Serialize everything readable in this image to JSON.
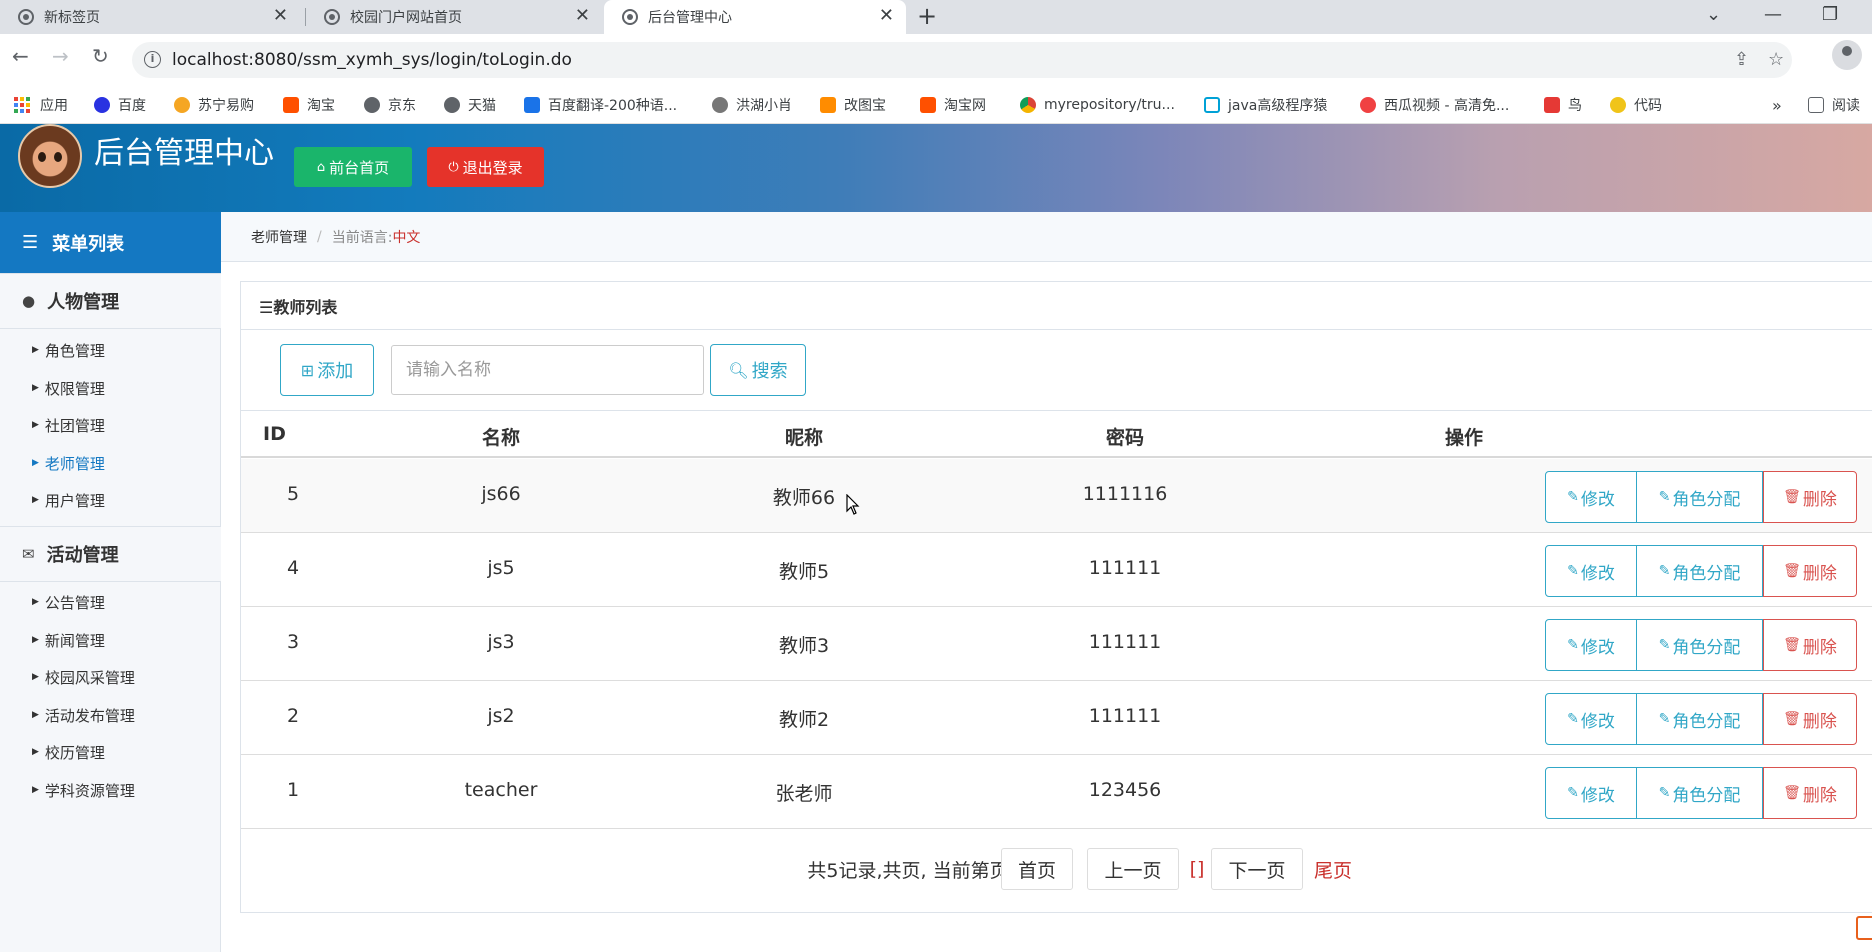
{
  "browser": {
    "tabs": [
      {
        "title": "新标签页",
        "icon": "chrome-icon"
      },
      {
        "title": "校园门户网站首页",
        "icon": "globe-icon"
      },
      {
        "title": "后台管理中心",
        "icon": "globe-icon",
        "active": true
      }
    ],
    "url": "localhost:8080/ssm_xymh_sys/login/toLogin.do",
    "bookmarks": [
      {
        "label": "应用",
        "icon": "apps-grid-icon"
      },
      {
        "label": "百度",
        "icon": "baidu-paw-icon",
        "color": "#2932e1"
      },
      {
        "label": "苏宁易购",
        "icon": "suning-icon",
        "color": "#f5a623"
      },
      {
        "label": "淘宝",
        "icon": "taobao-icon",
        "color": "#ff5000"
      },
      {
        "label": "京东",
        "icon": "globe-icon",
        "color": "#5f6368"
      },
      {
        "label": "天猫",
        "icon": "globe-icon",
        "color": "#5f6368"
      },
      {
        "label": "百度翻译-200种语...",
        "icon": "translate-icon",
        "color": "#1a73e8"
      },
      {
        "label": "洪湖小肖",
        "icon": "bird-icon",
        "color": "#555"
      },
      {
        "label": "改图宝",
        "icon": "gaitubao-icon",
        "color": "#ff8c00"
      },
      {
        "label": "淘宝网",
        "icon": "taobao-icon",
        "color": "#ff5000"
      },
      {
        "label": "myrepository/tru...",
        "icon": "chrome-icon",
        "color": "#db4437"
      },
      {
        "label": "java高级程序猿",
        "icon": "bilibili-icon",
        "color": "#00a1d6"
      },
      {
        "label": "西瓜视频 - 高清免...",
        "icon": "xigua-icon",
        "color": "#f04142"
      },
      {
        "label": "鸟",
        "icon": "bird-icon",
        "color": "#e53935"
      },
      {
        "label": "代码",
        "icon": "moon-icon",
        "color": "#f0c419"
      }
    ],
    "bookmarks_more": "»",
    "reading_list": "阅读"
  },
  "header": {
    "title": "后台管理中心",
    "home_button": "前台首页",
    "logout_button": "退出登录",
    "home_color": "#1ab56b",
    "logout_color": "#e5332a"
  },
  "sidebar": {
    "title": "菜单列表",
    "groups": [
      {
        "label": "人物管理",
        "icon": "user-icon",
        "items": [
          "角色管理",
          "权限管理",
          "社团管理",
          "老师管理",
          "用户管理"
        ]
      },
      {
        "label": "活动管理",
        "icon": "envelope-icon",
        "items": [
          "公告管理",
          "新闻管理",
          "校园风采管理",
          "活动发布管理",
          "校历管理",
          "学科资源管理"
        ]
      }
    ],
    "active_item": "老师管理"
  },
  "breadcrumb": {
    "section": "老师管理",
    "lang_label": "当前语言:",
    "lang_value": "中文"
  },
  "panel": {
    "title": "☰教师列表",
    "add_button": "添加",
    "search_placeholder": "请输入名称",
    "search_button": "搜索"
  },
  "table": {
    "columns": [
      "ID",
      "名称",
      "昵称",
      "密码",
      "操作"
    ],
    "rows": [
      {
        "id": "5",
        "name": "js66",
        "nickname": "教师66",
        "password": "1111116"
      },
      {
        "id": "4",
        "name": "js5",
        "nickname": "教师5",
        "password": "111111"
      },
      {
        "id": "3",
        "name": "js3",
        "nickname": "教师3",
        "password": "111111"
      },
      {
        "id": "2",
        "name": "js2",
        "nickname": "教师2",
        "password": "111111"
      },
      {
        "id": "1",
        "name": "teacher",
        "nickname": "张老师",
        "password": "123456"
      }
    ],
    "actions": {
      "edit": "修改",
      "role": "角色分配",
      "delete": "删除"
    }
  },
  "pager": {
    "summary": "共5记录,共页, 当前第页",
    "first": "首页",
    "prev": "上一页",
    "current": "[]",
    "next": "下一页",
    "last": "尾页"
  }
}
